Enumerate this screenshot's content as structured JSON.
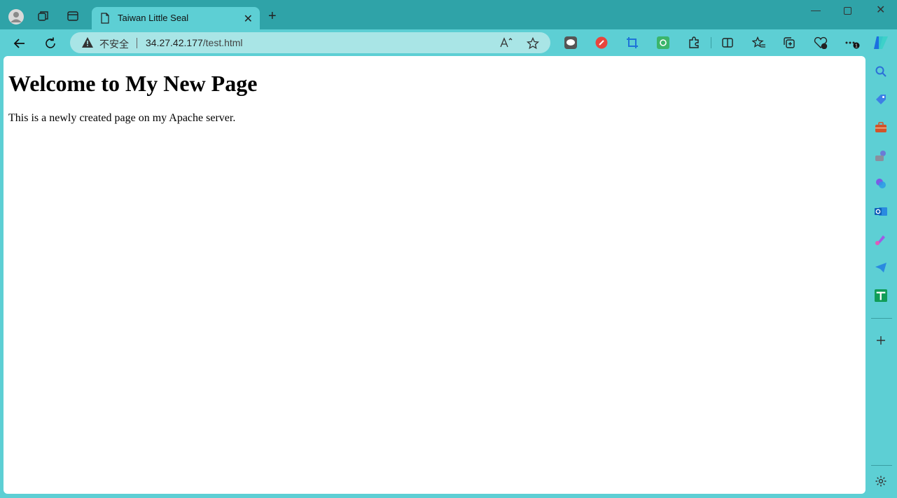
{
  "tab": {
    "title": "Taiwan Little Seal"
  },
  "address_bar": {
    "security_label": "不安全",
    "url_host": "34.27.42.177",
    "url_path": "/test.html"
  },
  "page": {
    "heading": "Welcome to My New Page",
    "paragraph": "This is a newly created page on my Apache server."
  },
  "colors": {
    "frame": "#5dcfd4",
    "titlebar": "#2fa3a8",
    "address_bar": "#a9e5e6"
  },
  "icons": {
    "titlebar": [
      "profile-icon",
      "workspaces-icon",
      "tab-actions-icon"
    ],
    "toolbar": [
      "back-icon",
      "refresh-icon",
      "warning-icon",
      "read-aloud-icon",
      "favorite-star-icon"
    ],
    "extensions": [
      "line-extension-icon",
      "red-extension-icon",
      "crop-extension-icon",
      "green-extension-icon",
      "extensions-puzzle-icon",
      "split-screen-icon",
      "favorites-icon",
      "collections-icon",
      "browser-essentials-icon",
      "more-options-icon",
      "copilot-icon"
    ],
    "sidebar": [
      "search-icon",
      "shopping-tag-icon",
      "toolbox-icon",
      "games-icon",
      "copilot-sidebar-icon",
      "outlook-icon",
      "designer-icon",
      "telegram-icon",
      "sheets-icon",
      "add-icon",
      "settings-icon"
    ]
  }
}
